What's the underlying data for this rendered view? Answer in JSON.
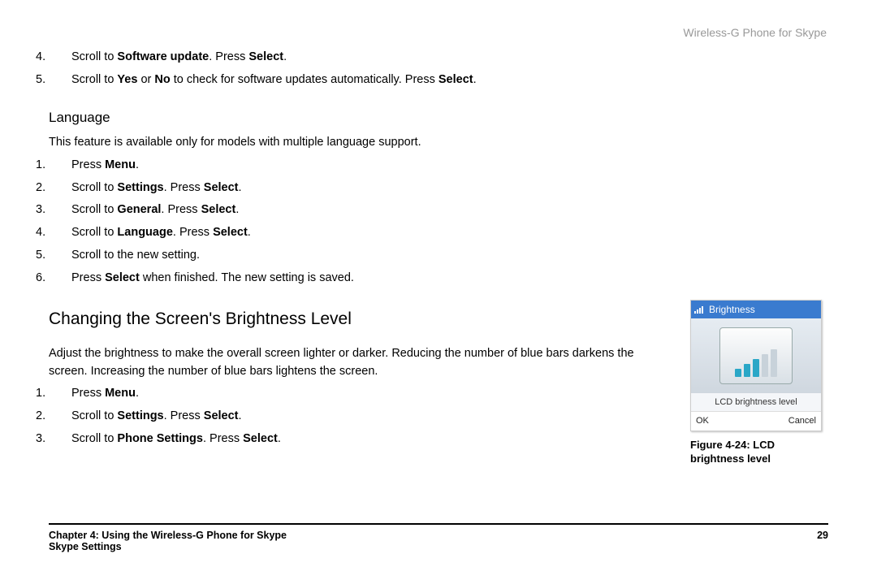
{
  "header": {
    "product": "Wireless-G Phone for Skype"
  },
  "list1": [
    {
      "num": "4.",
      "parts": [
        "Scroll to ",
        "Software update",
        ". Press ",
        "Select",
        "."
      ]
    },
    {
      "num": "5.",
      "parts": [
        "Scroll to ",
        "Yes",
        " or ",
        "No",
        " to check for software updates automatically. Press ",
        "Select",
        "."
      ]
    }
  ],
  "language": {
    "heading": "Language",
    "intro": "This feature is available only for models with multiple language support.",
    "steps": [
      {
        "num": "1.",
        "parts": [
          "Press ",
          "Menu",
          "."
        ]
      },
      {
        "num": "2.",
        "parts": [
          "Scroll to ",
          "Settings",
          ". Press ",
          "Select",
          "."
        ]
      },
      {
        "num": "3.",
        "parts": [
          "Scroll to ",
          "General",
          ". Press ",
          "Select",
          "."
        ]
      },
      {
        "num": "4.",
        "parts": [
          "Scroll to ",
          "Language",
          ". Press ",
          "Select",
          "."
        ]
      },
      {
        "num": "5.",
        "parts": [
          "Scroll to the new setting."
        ]
      },
      {
        "num": "6.",
        "parts": [
          "Press ",
          "Select",
          " when finished. The new setting is saved."
        ]
      }
    ]
  },
  "brightness": {
    "heading": "Changing the Screen's Brightness Level",
    "intro": "Adjust the brightness to make the overall screen lighter or darker. Reducing the number of blue bars darkens the screen. Increasing the number of blue bars lightens the screen.",
    "steps": [
      {
        "num": "1.",
        "parts": [
          "Press ",
          "Menu",
          "."
        ]
      },
      {
        "num": "2.",
        "parts": [
          "Scroll to ",
          "Settings",
          ". Press ",
          "Select",
          "."
        ]
      },
      {
        "num": "3.",
        "parts": [
          "Scroll to ",
          "Phone Settings",
          ". Press ",
          "Select",
          "."
        ]
      }
    ]
  },
  "figure": {
    "topbar": "Brightness",
    "label": "LCD brightness level",
    "ok": "OK",
    "cancel": "Cancel",
    "caption1": "Figure 4-24: LCD",
    "caption2": "brightness level"
  },
  "footer": {
    "chapter": "Chapter 4: Using the Wireless-G Phone for Skype",
    "sub": "Skype Settings",
    "page": "29"
  }
}
